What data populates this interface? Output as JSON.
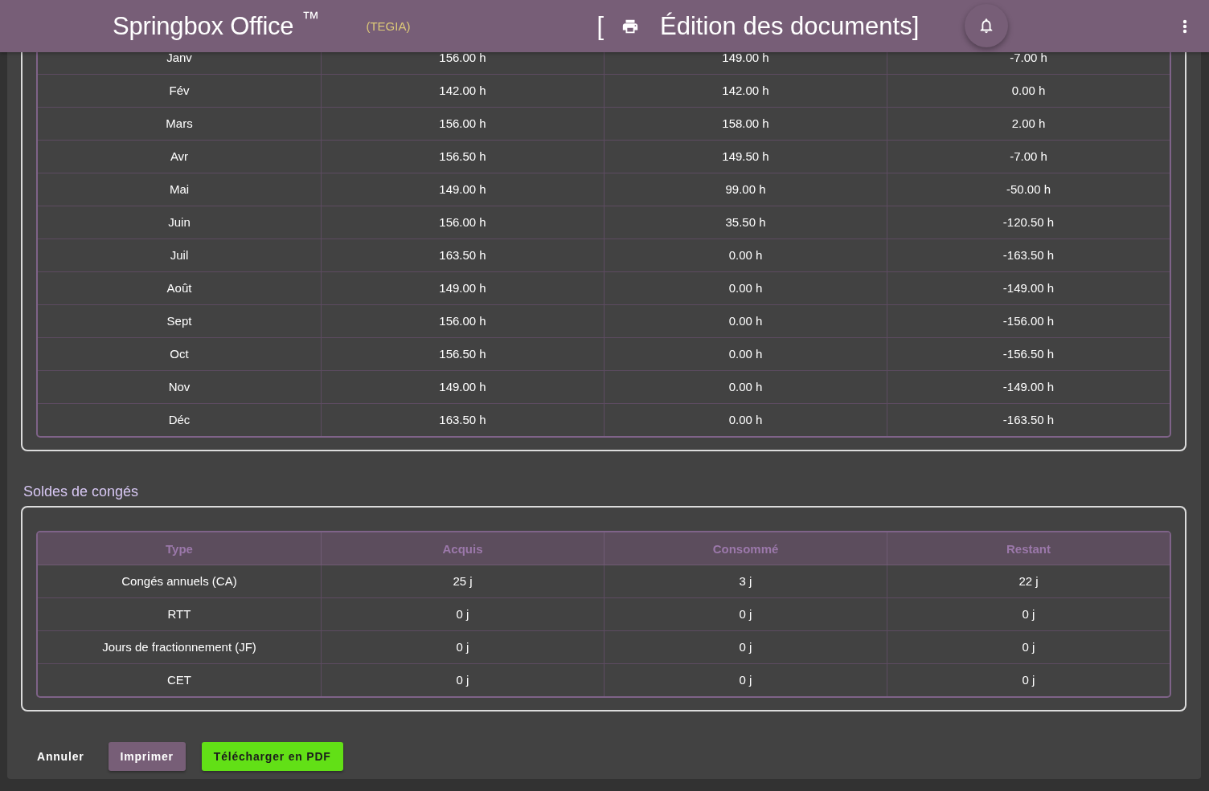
{
  "app_bar": {
    "app_name": "Springbox Office",
    "trademark": "™",
    "company": "(TEGIA)",
    "title_bracket": "[",
    "title": "Édition des documents]"
  },
  "hours_table": {
    "rows": [
      [
        "Janv",
        "156.00 h",
        "149.00 h",
        "-7.00 h"
      ],
      [
        "Fév",
        "142.00 h",
        "142.00 h",
        "0.00 h"
      ],
      [
        "Mars",
        "156.00 h",
        "158.00 h",
        "2.00 h"
      ],
      [
        "Avr",
        "156.50 h",
        "149.50 h",
        "-7.00 h"
      ],
      [
        "Mai",
        "149.00 h",
        "99.00 h",
        "-50.00 h"
      ],
      [
        "Juin",
        "156.00 h",
        "35.50 h",
        "-120.50 h"
      ],
      [
        "Juil",
        "163.50 h",
        "0.00 h",
        "-163.50 h"
      ],
      [
        "Août",
        "149.00 h",
        "0.00 h",
        "-149.00 h"
      ],
      [
        "Sept",
        "156.00 h",
        "0.00 h",
        "-156.00 h"
      ],
      [
        "Oct",
        "156.50 h",
        "0.00 h",
        "-156.50 h"
      ],
      [
        "Nov",
        "149.00 h",
        "0.00 h",
        "-149.00 h"
      ],
      [
        "Déc",
        "163.50 h",
        "0.00 h",
        "-163.50 h"
      ]
    ]
  },
  "leave_balances": {
    "title": "Soldes de congés",
    "columns": [
      "Type",
      "Acquis",
      "Consommé",
      "Restant"
    ],
    "rows": [
      [
        "Congés annuels (CA)",
        "25 j",
        "3 j",
        "22 j"
      ],
      [
        "RTT",
        "0 j",
        "0 j",
        "0 j"
      ],
      [
        "Jours de fractionnement (JF)",
        "0 j",
        "0 j",
        "0 j"
      ],
      [
        "CET",
        "0 j",
        "0 j",
        "0 j"
      ]
    ]
  },
  "actions": [
    {
      "label": "Annuler",
      "kind": "cancel"
    },
    {
      "label": "Imprimer",
      "kind": "print"
    },
    {
      "label": "Télécharger en PDF",
      "kind": "download"
    }
  ]
}
